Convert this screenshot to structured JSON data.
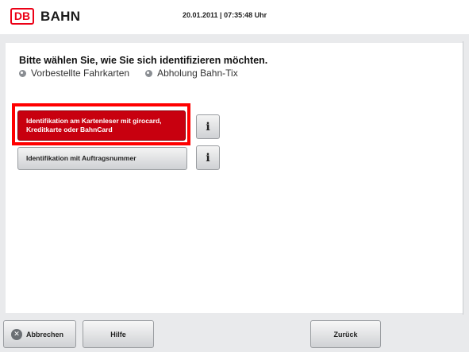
{
  "header": {
    "logo_text": "DB",
    "brand": "BAHN",
    "datetime": "20.01.2011 | 07:35:48 Uhr"
  },
  "main": {
    "heading": "Bitte wählen Sie, wie Sie sich identifizieren möchten.",
    "steps": [
      "Vorbestellte Fahrkarten",
      "Abholung Bahn-Tix"
    ],
    "options": [
      {
        "label": "Identifikation am Kartenleser mit girocard, Kreditkarte oder BahnCard",
        "info": "i"
      },
      {
        "label": "Identifikation mit Auftragsnummer",
        "info": "i"
      }
    ]
  },
  "footer": {
    "cancel_label": "Abbrechen",
    "cancel_icon": "✕",
    "help_label": "Hilfe",
    "back_label": "Zurück"
  },
  "colors": {
    "brand_red": "#ec0016",
    "selected_button": "#c8000f",
    "highlight_frame": "#ff0000"
  }
}
